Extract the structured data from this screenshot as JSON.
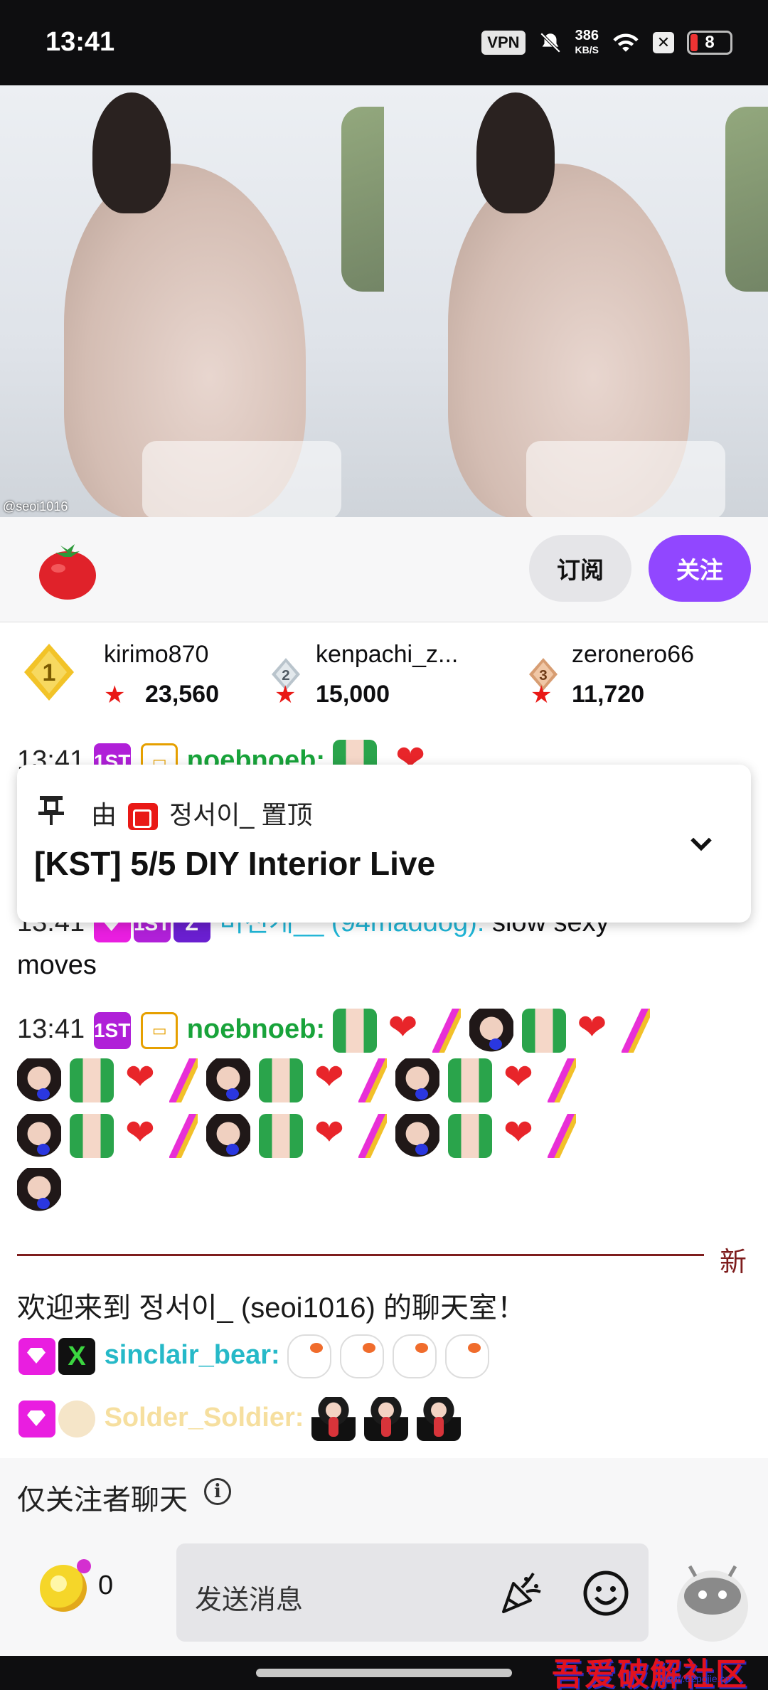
{
  "status_bar": {
    "time": "13:41",
    "vpn": "VPN",
    "speed_value": "386",
    "speed_unit": "KB/S",
    "battery": "8"
  },
  "video": {
    "instagram_handle": "@seoi1016"
  },
  "actions": {
    "subscribe_label": "订阅",
    "follow_label": "关注"
  },
  "leaderboard": [
    {
      "rank": "1",
      "name": "kirimo870",
      "score": "23,560"
    },
    {
      "rank": "2",
      "name": "kenpachi_z...",
      "score": "15,000"
    },
    {
      "rank": "3",
      "name": "zeronero66",
      "score": "11,720"
    }
  ],
  "chat": {
    "line_top": {
      "time": "13:41",
      "user": "noebnoeb:"
    },
    "line1": {
      "time": "13:41",
      "user": "미친개__ (94maddog):",
      "text": "slow sexy",
      "text2": "moves"
    },
    "line2": {
      "time": "13:41",
      "user": "noebnoeb:"
    },
    "new_label": "新",
    "welcome": "欢迎来到 정서이_ (seoi1016) 的聊天室！",
    "line3": {
      "user": "sinclair_bear:"
    },
    "line4": {
      "user": "Solder_Soldier:"
    }
  },
  "pinned": {
    "by_prefix": "由",
    "by_name": "정서이_",
    "by_suffix": "置顶",
    "message": "[KST] 5/5 DIY Interior Live"
  },
  "followers_only": "仅关注者聊天",
  "composer": {
    "bits_count": "0",
    "placeholder": "发送消息"
  },
  "watermark": {
    "site": "吾爱破解社区",
    "url": "www.52pojie.cn"
  },
  "colors": {
    "accent": "#9147ff",
    "new_divider": "#7e1d1d"
  }
}
